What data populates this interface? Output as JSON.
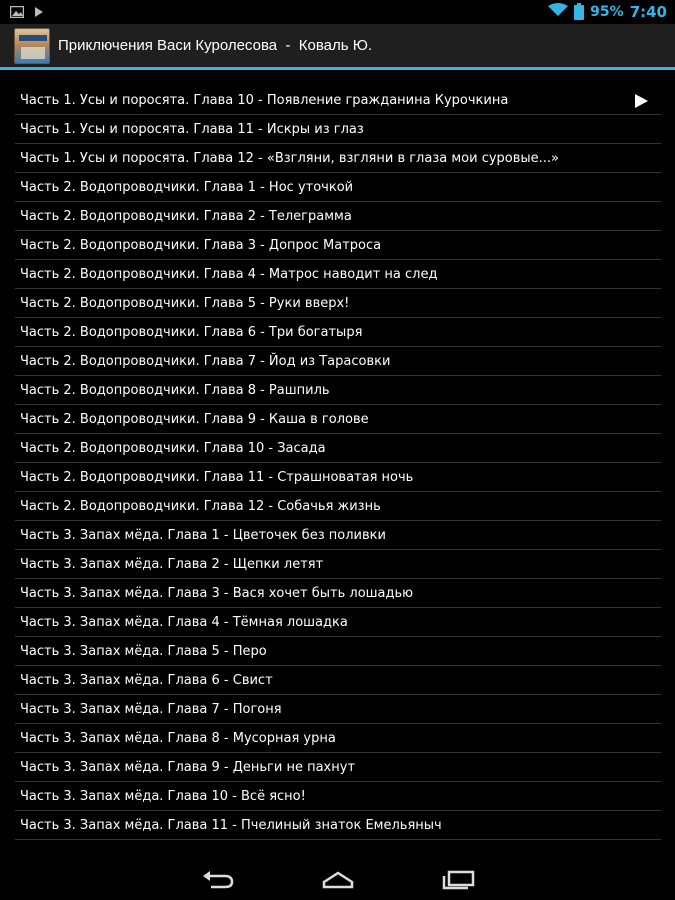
{
  "status_bar": {
    "battery_text": "95%",
    "time": "7:40",
    "icons": [
      "gallery-icon",
      "play-store-icon",
      "wifi-icon",
      "battery-icon"
    ],
    "accent": "#33b5e5"
  },
  "action_bar": {
    "title": "Приключения Васи Куролесова  -  Коваль Ю.",
    "accent": "#33b5e5"
  },
  "chapters": [
    {
      "label": "Часть 1. Усы и поросята. Глава 10 - Появление гражданина Курочкина",
      "playing": true
    },
    {
      "label": "Часть 1. Усы и поросята. Глава 11 - Искры из глаз"
    },
    {
      "label": "Часть 1. Усы и поросята. Глава 12 - «Взгляни, взгляни в глаза мои суровые...»"
    },
    {
      "label": "Часть 2. Водопроводчики. Глава 1 - Нос уточкой"
    },
    {
      "label": "Часть 2. Водопроводчики. Глава 2 - Телеграмма"
    },
    {
      "label": "Часть 2. Водопроводчики. Глава 3 - Допрос Матроса"
    },
    {
      "label": "Часть 2. Водопроводчики. Глава 4 - Матрос наводит на след"
    },
    {
      "label": "Часть 2. Водопроводчики. Глава 5 - Руки вверх!"
    },
    {
      "label": "Часть 2. Водопроводчики. Глава 6 - Три богатыря"
    },
    {
      "label": "Часть 2. Водопроводчики. Глава 7 - Йод из Тарасовки"
    },
    {
      "label": "Часть 2. Водопроводчики. Глава 8 - Рашпиль"
    },
    {
      "label": "Часть 2. Водопроводчики. Глава 9 - Каша в голове"
    },
    {
      "label": "Часть 2. Водопроводчики. Глава 10 - Засада"
    },
    {
      "label": "Часть 2. Водопроводчики. Глава 11 - Страшноватая ночь"
    },
    {
      "label": "Часть 2. Водопроводчики. Глава 12 - Собачья жизнь"
    },
    {
      "label": "Часть 3. Запах мёда. Глава 1 - Цветочек без поливки"
    },
    {
      "label": "Часть 3. Запах мёда. Глава 2 - Щепки летят"
    },
    {
      "label": "Часть 3. Запах мёда. Глава 3 - Вася хочет быть лошадью"
    },
    {
      "label": "Часть 3. Запах мёда. Глава 4 - Тёмная лошадка"
    },
    {
      "label": "Часть 3. Запах мёда. Глава 5 - Перо"
    },
    {
      "label": "Часть 3. Запах мёда. Глава 6 - Свист"
    },
    {
      "label": "Часть 3. Запах мёда. Глава 7 - Погоня"
    },
    {
      "label": "Часть 3. Запах мёда. Глава 8 - Мусорная урна"
    },
    {
      "label": "Часть 3. Запах мёда. Глава 9 - Деньги не пахнут"
    },
    {
      "label": "Часть 3. Запах мёда. Глава 10 - Всё ясно!"
    },
    {
      "label": "Часть 3. Запах мёда. Глава 11 - Пчелиный знаток Емельяныч"
    }
  ],
  "nav_bar": {
    "buttons": [
      "back-icon",
      "home-icon",
      "recent-apps-icon"
    ]
  }
}
